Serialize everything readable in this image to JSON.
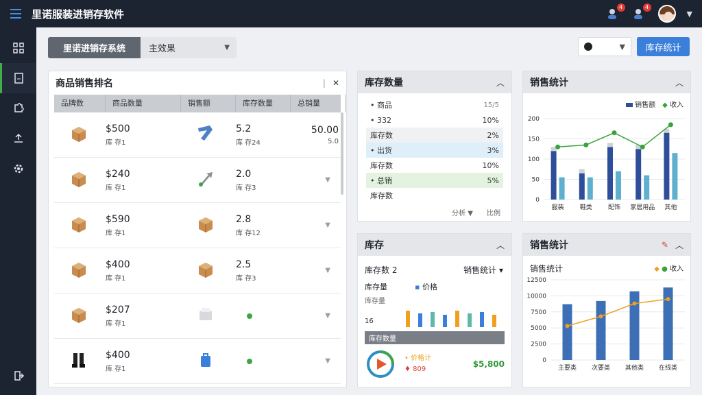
{
  "app": {
    "title": "里诺服装进销存软件",
    "badge1": "4",
    "badge2": "4"
  },
  "toolbar": {
    "tab_primary": "里诺进销存系统",
    "tab_select": "主效果",
    "primary_button": "库存统计"
  },
  "products": {
    "title": "商品销售排名",
    "columns": [
      "品牌数",
      "商品数量",
      "销售额",
      "库存数量",
      "总销量"
    ],
    "rows": [
      {
        "price": "$500",
        "sub": "库 存1",
        "qty": "5.2",
        "qty_sub": "库 存24",
        "total": "50.00",
        "total_sub": "5.0"
      },
      {
        "price": "$240",
        "sub": "库 存1",
        "qty": "2.0",
        "qty_sub": "库 存3",
        "total": "",
        "total_sub": ""
      },
      {
        "price": "$590",
        "sub": "库 存1",
        "qty": "2.8",
        "qty_sub": "库 存12",
        "total": "",
        "total_sub": ""
      },
      {
        "price": "$400",
        "sub": "库 存1",
        "qty": "2.5",
        "qty_sub": "库 存3",
        "total": "",
        "total_sub": ""
      },
      {
        "price": "$207",
        "sub": "库 存1",
        "qty": "",
        "qty_sub": "",
        "total": "",
        "total_sub": ""
      },
      {
        "price": "$400",
        "sub": "库 存1",
        "qty": "",
        "qty_sub": "",
        "total": "",
        "total_sub": ""
      }
    ]
  },
  "inventory_qty": {
    "title": "库存数量",
    "rows": [
      {
        "label": "• 商品",
        "value": "15/5"
      },
      {
        "label": "• 332",
        "value": "10%"
      },
      {
        "label": "库存数",
        "value": "2%"
      },
      {
        "label": "• 出货",
        "value": "3%"
      },
      {
        "label": "库存数",
        "value": "10%"
      },
      {
        "label": "• 总销",
        "value": "5%"
      },
      {
        "label": "库存数",
        "value": ""
      }
    ],
    "footer": [
      "分析 ▼",
      "比例"
    ]
  },
  "sales_chart_1": {
    "title": "销售统计",
    "legend": [
      "销售额",
      "收入"
    ]
  },
  "stock_panel": {
    "title": "库存",
    "subtitle": "库存数 2",
    "dropdown": "销售统计",
    "label_a": "库存量",
    "label_b": "价格",
    "label_c": "库存量",
    "label_d": "16",
    "band_label": "库存数量",
    "ring_label_1": "• 价格计",
    "ring_label_2": "♦ 809",
    "amount": "$5,800"
  },
  "sales_chart_2": {
    "title": "销售统计",
    "subtitle": "销售统计",
    "legend": [
      "收入"
    ]
  },
  "chart_data": [
    {
      "type": "bar",
      "title": "销售统计",
      "yticks": [
        0,
        50,
        100,
        150,
        200
      ],
      "categories": [
        "服装",
        "鞋类",
        "配饰",
        "家居用品",
        "其他"
      ],
      "series": [
        {
          "name": "销售额",
          "values": [
            120,
            65,
            130,
            125,
            165
          ]
        },
        {
          "name": "",
          "values": [
            55,
            55,
            70,
            60,
            115
          ]
        },
        {
          "name": "收入",
          "values": [
            130,
            135,
            165,
            130,
            185
          ]
        }
      ],
      "ylim": [
        0,
        200
      ]
    },
    {
      "type": "bar",
      "title": "销售统计",
      "yticks": [
        0,
        2500,
        5000,
        7500,
        10000,
        12500
      ],
      "categories": [
        "主要类",
        "次要类",
        "其他类",
        "在线类"
      ],
      "series": [
        {
          "name": "",
          "values": [
            8700,
            9200,
            10700,
            11300
          ]
        },
        {
          "name": "收入",
          "values": [
            5300,
            6800,
            8800,
            9500
          ]
        }
      ],
      "ylim": [
        0,
        12500
      ]
    }
  ]
}
